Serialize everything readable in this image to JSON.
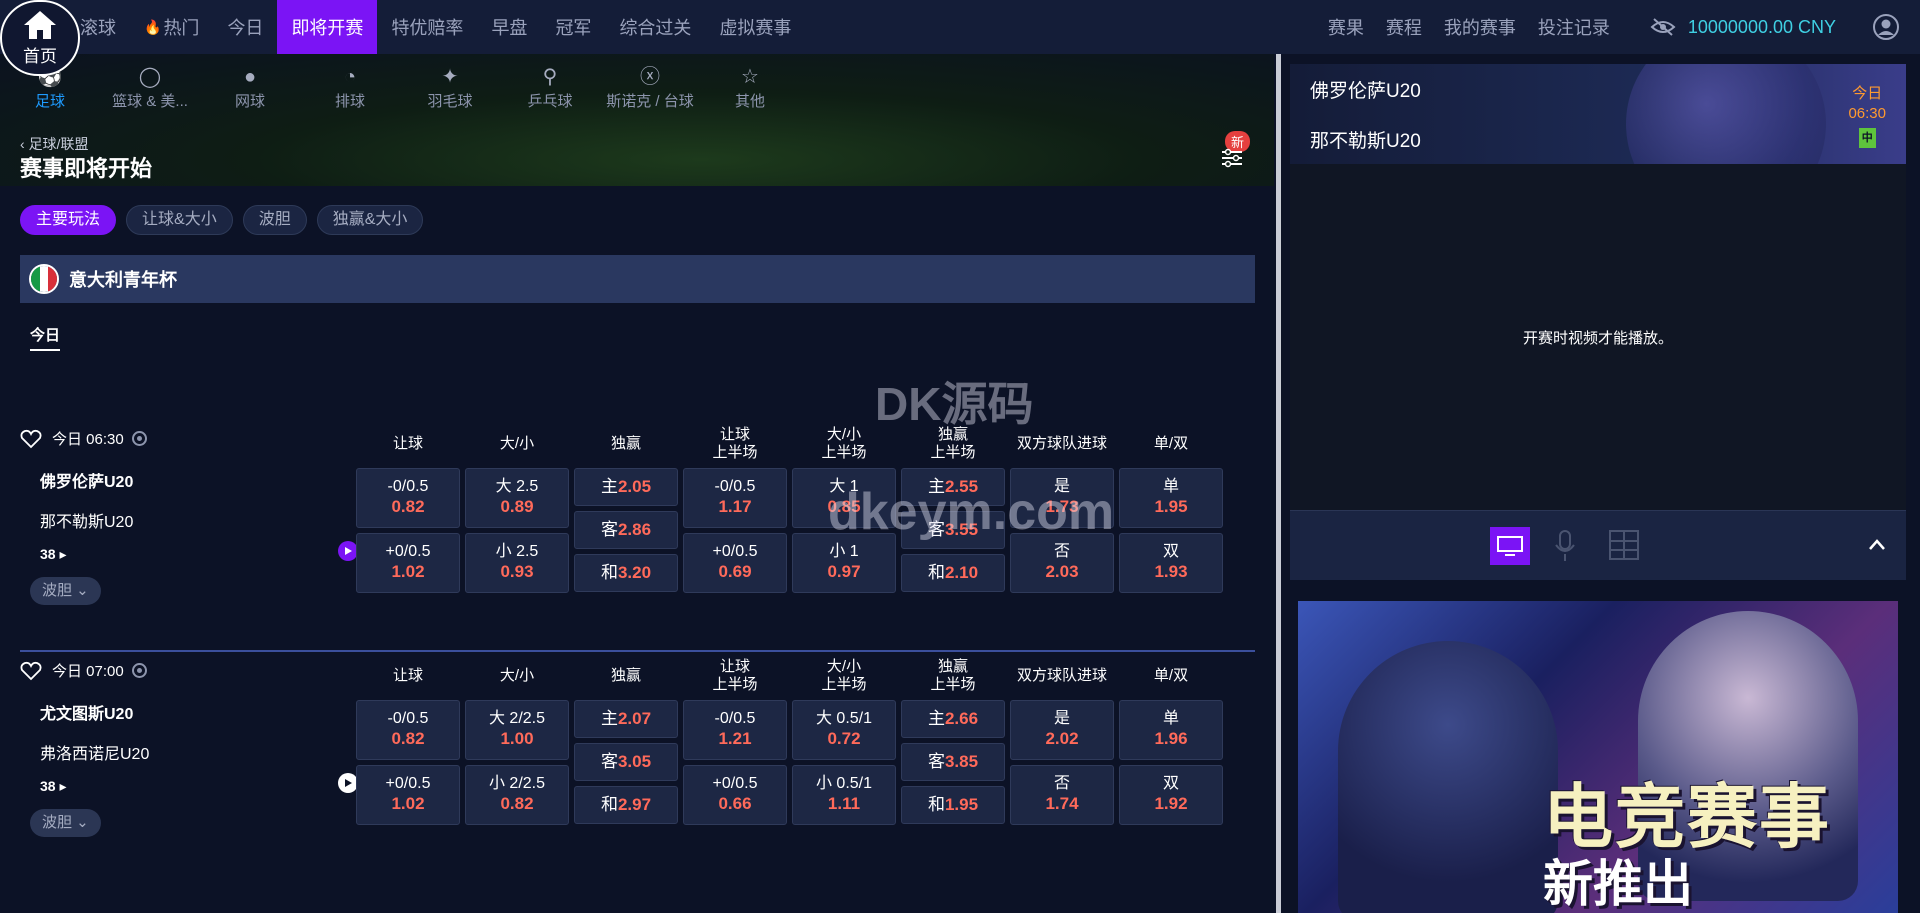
{
  "topbar": {
    "home_label": "首页",
    "nav": [
      "滚球",
      "热门",
      "今日",
      "即将开赛",
      "特优赔率",
      "早盘",
      "冠军",
      "综合过关",
      "虚拟赛事"
    ],
    "right_nav": [
      "赛果",
      "赛程",
      "我的赛事",
      "投注记录"
    ],
    "balance": "10000000.00  CNY"
  },
  "sports": [
    "足球",
    "篮球 & 美...",
    "网球",
    "排球",
    "羽毛球",
    "乒乓球",
    "斯诺克 / 台球",
    "其他"
  ],
  "header": {
    "breadcrumb": "足球/联盟",
    "title": "赛事即将开始",
    "new_badge": "新"
  },
  "tabs": [
    "主要玩法",
    "让球&大小",
    "波胆",
    "独赢&大小"
  ],
  "league": {
    "name": "意大利青年杯"
  },
  "day_tab": "今日",
  "columns": [
    "让球",
    "大/小",
    "独赢",
    "让球\n上半场",
    "大/小\n上半场",
    "独赢\n上半场",
    "双方球队进球",
    "单/双"
  ],
  "matches": [
    {
      "time": "今日 06:30",
      "home": "佛罗伦萨U20",
      "away": "那不勒斯U20",
      "more": "38",
      "bodan": "波胆",
      "handicap": [
        {
          "l": "-0/0.5",
          "o": "0.82"
        },
        {
          "l": "+0/0.5",
          "o": "1.02"
        }
      ],
      "ou": [
        {
          "l": "大 2.5",
          "o": "0.89"
        },
        {
          "l": "小 2.5",
          "o": "0.93"
        }
      ],
      "win": [
        {
          "l": "主",
          "o": "2.05"
        },
        {
          "l": "客",
          "o": "2.86"
        },
        {
          "l": "和",
          "o": "3.20"
        }
      ],
      "handicap_h1": [
        {
          "l": "-0/0.5",
          "o": "1.17"
        },
        {
          "l": "+0/0.5",
          "o": "0.69"
        }
      ],
      "ou_h1": [
        {
          "l": "大 1",
          "o": "0.85"
        },
        {
          "l": "小 1",
          "o": "0.97"
        }
      ],
      "win_h1": [
        {
          "l": "主",
          "o": "2.55"
        },
        {
          "l": "客",
          "o": "3.55"
        },
        {
          "l": "和",
          "o": "2.10"
        }
      ],
      "btts": [
        {
          "l": "是",
          "o": "1.73"
        },
        {
          "l": "否",
          "o": "2.03"
        }
      ],
      "oe": [
        {
          "l": "单",
          "o": "1.95"
        },
        {
          "l": "双",
          "o": "1.93"
        }
      ]
    },
    {
      "time": "今日 07:00",
      "home": "尤文图斯U20",
      "away": "弗洛西诺尼U20",
      "more": "38",
      "bodan": "波胆",
      "handicap": [
        {
          "l": "-0/0.5",
          "o": "0.82"
        },
        {
          "l": "+0/0.5",
          "o": "1.02"
        }
      ],
      "ou": [
        {
          "l": "大 2/2.5",
          "o": "1.00"
        },
        {
          "l": "小 2/2.5",
          "o": "0.82"
        }
      ],
      "win": [
        {
          "l": "主",
          "o": "2.07"
        },
        {
          "l": "客",
          "o": "3.05"
        },
        {
          "l": "和",
          "o": "2.97"
        }
      ],
      "handicap_h1": [
        {
          "l": "-0/0.5",
          "o": "1.21"
        },
        {
          "l": "+0/0.5",
          "o": "0.66"
        }
      ],
      "ou_h1": [
        {
          "l": "大 0.5/1",
          "o": "0.72"
        },
        {
          "l": "小 0.5/1",
          "o": "1.11"
        }
      ],
      "win_h1": [
        {
          "l": "主",
          "o": "2.66"
        },
        {
          "l": "客",
          "o": "3.85"
        },
        {
          "l": "和",
          "o": "1.95"
        }
      ],
      "btts": [
        {
          "l": "是",
          "o": "2.02"
        },
        {
          "l": "否",
          "o": "1.74"
        }
      ],
      "oe": [
        {
          "l": "单",
          "o": "1.96"
        },
        {
          "l": "双",
          "o": "1.92"
        }
      ]
    }
  ],
  "side": {
    "home": "佛罗伦萨U20",
    "away": "那不勒斯U20",
    "date": "今日",
    "time": "06:30",
    "badge": "中",
    "video_msg": "开赛时视频才能播放。",
    "banner_title": "电竞赛事",
    "banner_sub": "新推出"
  },
  "watermark": {
    "line1": "DK源码",
    "line2": "dkeym.com"
  },
  "colors": {
    "accent": "#7b14f5",
    "odds": "#ff6a5a",
    "balance": "#3fd0e3"
  }
}
